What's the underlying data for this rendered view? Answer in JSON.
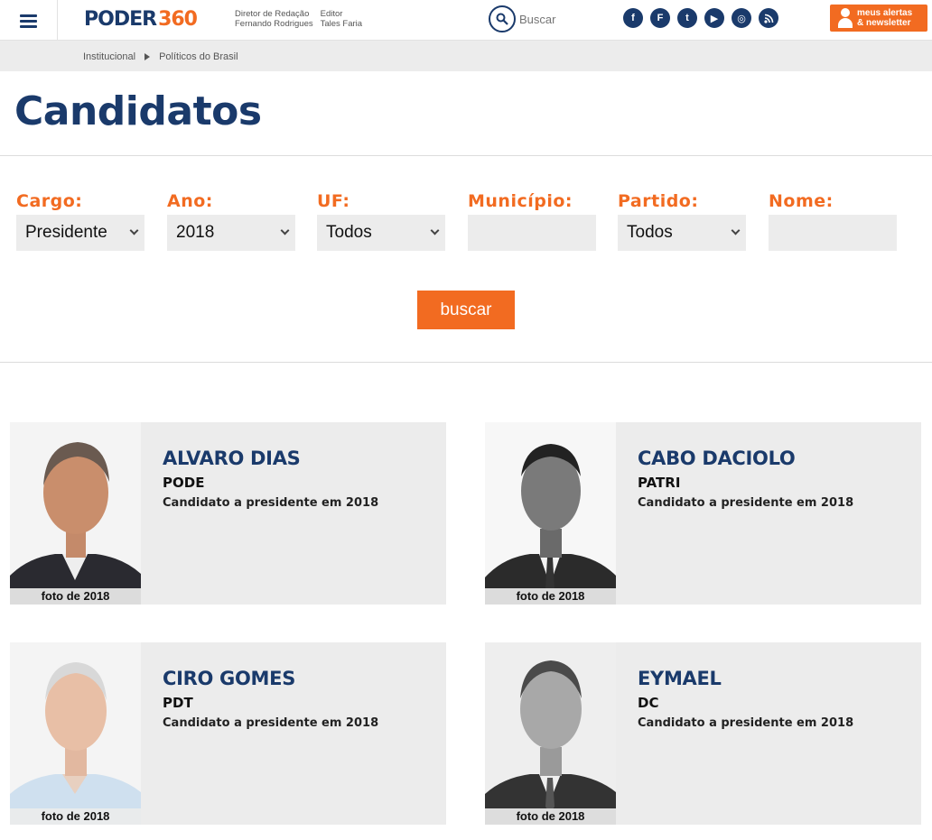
{
  "header": {
    "logo_left": "PODER",
    "logo_right": "360",
    "director_title": "Diretor de Redação",
    "director_name": "Fernando Rodrigues",
    "editor_title": "Editor",
    "editor_name": "Tales Faria",
    "search_placeholder": "Buscar",
    "alerts_line1": "meus alertas",
    "alerts_line2": "& newsletter",
    "socials": [
      "f",
      "F",
      "t",
      "▶",
      "◎",
      "rss"
    ]
  },
  "breadcrumb": [
    "Institucional",
    "Políticos do Brasil"
  ],
  "page_title": "Candidatos",
  "filters": {
    "cargo_label": "Cargo:",
    "cargo_value": "Presidente",
    "ano_label": "Ano:",
    "ano_value": "2018",
    "uf_label": "UF:",
    "uf_value": "Todos",
    "municipio_label": "Município:",
    "municipio_value": "",
    "partido_label": "Partido:",
    "partido_value": "Todos",
    "nome_label": "Nome:",
    "nome_value": ""
  },
  "search_button": "buscar",
  "candidates": [
    {
      "name": "ALVARO DIAS",
      "party": "PODE",
      "desc": "Candidato a presidente em 2018",
      "caption": "foto de 2018"
    },
    {
      "name": "CABO DACIOLO",
      "party": "PATRI",
      "desc": "Candidato a presidente em 2018",
      "caption": "foto de 2018"
    },
    {
      "name": "CIRO GOMES",
      "party": "PDT",
      "desc": "Candidato a presidente em 2018",
      "caption": "foto de 2018"
    },
    {
      "name": "EYMAEL",
      "party": "DC",
      "desc": "Candidato a presidente em 2018",
      "caption": "foto de 2018"
    }
  ],
  "colors": {
    "brand_blue": "#1a3a6b",
    "brand_orange": "#f26b21"
  }
}
